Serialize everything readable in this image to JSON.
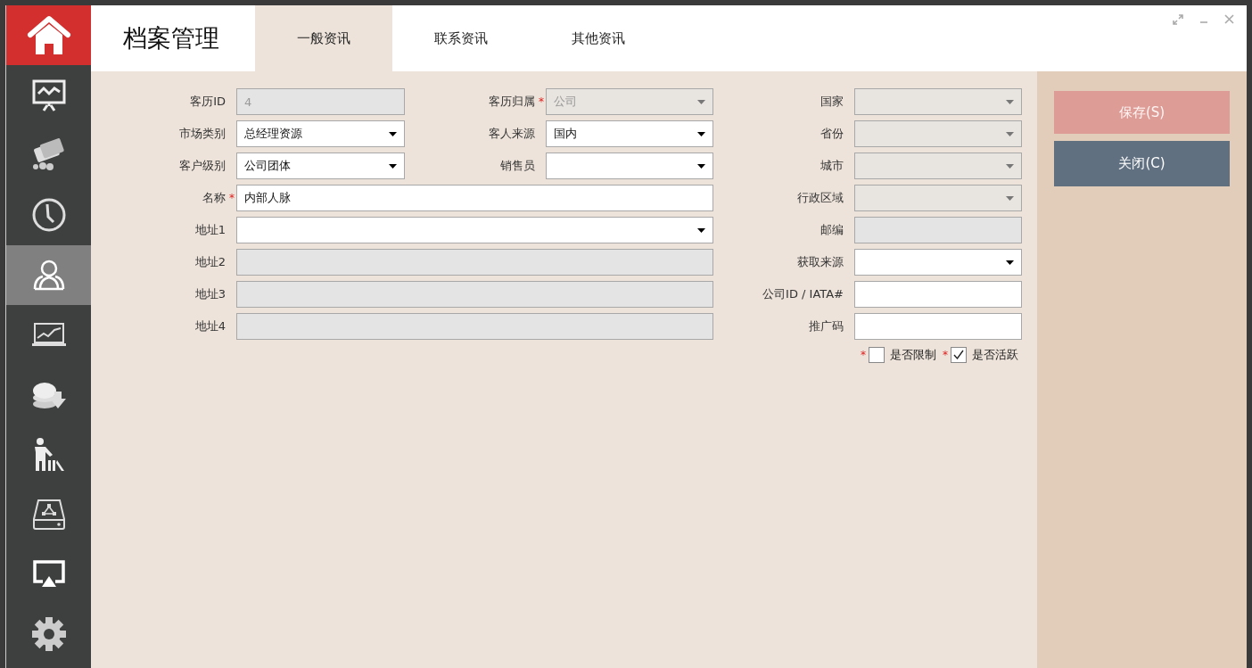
{
  "sidebar": {
    "items": [
      {
        "selected": false
      },
      {
        "selected": false
      },
      {
        "selected": false
      },
      {
        "selected": true
      },
      {
        "selected": false
      },
      {
        "selected": false
      },
      {
        "selected": false
      },
      {
        "selected": false
      },
      {
        "selected": false
      }
    ]
  },
  "header": {
    "title": "档案管理"
  },
  "tabs": [
    {
      "label": "一般资讯",
      "selected": true
    },
    {
      "label": "联系资讯",
      "selected": false
    },
    {
      "label": "其他资讯",
      "selected": false
    }
  ],
  "left_form": {
    "rows": [
      [
        {
          "label": "客历ID",
          "kind": "text",
          "value": "4",
          "disabled": true
        },
        {
          "label": "客历归属",
          "required_mark": "*",
          "kind": "dropdown",
          "value": "公司",
          "disabled": true
        }
      ],
      [
        {
          "label": "市场类别",
          "kind": "dropdown",
          "value": "总经理资源",
          "disabled": false
        },
        {
          "label": "客人来源",
          "kind": "dropdown",
          "value": "国内",
          "disabled": false
        }
      ],
      [
        {
          "label": "客户级别",
          "kind": "dropdown",
          "value": "公司团体",
          "disabled": false
        },
        {
          "label": "销售员",
          "kind": "dropdown",
          "disabled": false
        }
      ],
      [
        {
          "label": "名称",
          "required_mark": "*",
          "kind": "text",
          "value": "内部人脉",
          "disabled": false
        }
      ],
      [
        {
          "label": "地址1",
          "kind": "dropdown",
          "disabled": false
        }
      ],
      [
        {
          "label": "地址2",
          "kind": "text",
          "disabled": true
        }
      ],
      [
        {
          "label": "地址3",
          "kind": "text",
          "disabled": true
        }
      ],
      [
        {
          "label": "地址4",
          "kind": "text",
          "disabled": true
        }
      ]
    ]
  },
  "right_form": {
    "fields": [
      {
        "label": "国家",
        "kind": "dropdown",
        "disabled": true
      },
      {
        "label": "省份",
        "kind": "dropdown",
        "disabled": true
      },
      {
        "label": "城市",
        "kind": "dropdown",
        "disabled": true
      },
      {
        "label": "行政区域",
        "kind": "dropdown",
        "disabled": true
      },
      {
        "label": "邮编",
        "kind": "text",
        "disabled": true
      },
      {
        "label": "获取来源",
        "kind": "dropdown",
        "disabled": false
      },
      {
        "label": "公司ID / IATA#",
        "kind": "text",
        "disabled": false
      },
      {
        "label": "推广码",
        "kind": "text",
        "disabled": false
      }
    ],
    "checkboxes": [
      {
        "label": "是否限制",
        "checked": false,
        "required_mark": "*"
      },
      {
        "label": "是否活跃",
        "checked": true,
        "required_mark": "*"
      }
    ]
  },
  "actions": [
    {
      "label": "保存(S)",
      "disabled": true
    },
    {
      "label": "关闭(C)",
      "disabled": false
    }
  ]
}
